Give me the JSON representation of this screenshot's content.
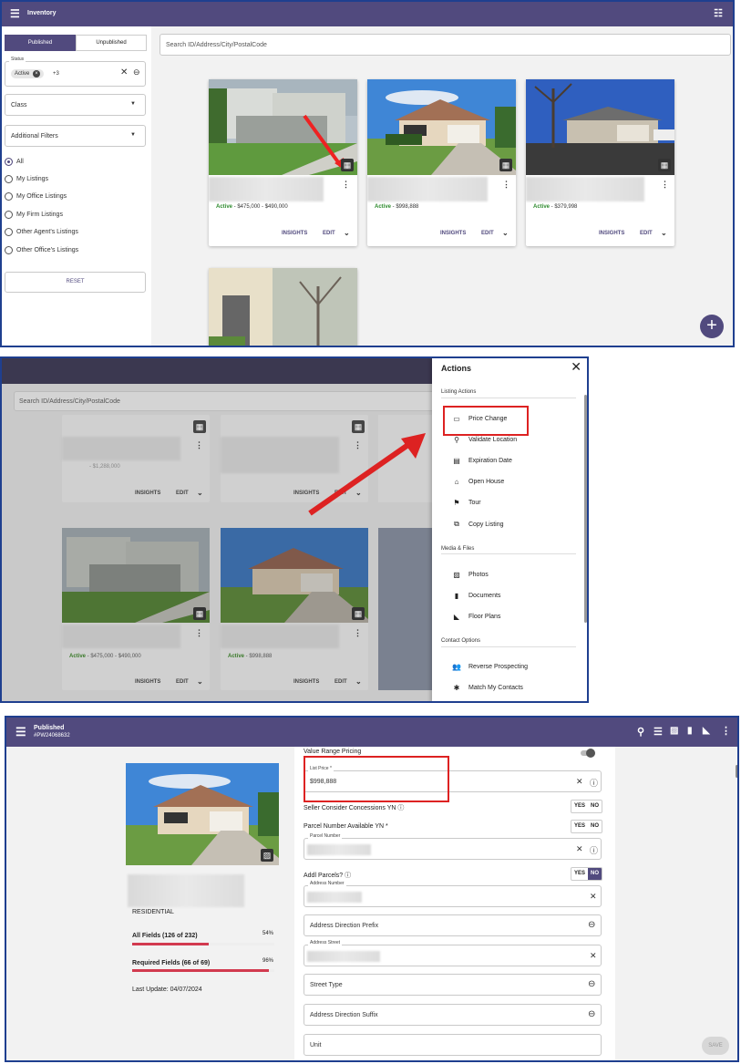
{
  "panel1": {
    "header": {
      "title": "Inventory"
    },
    "tabs": {
      "published": "Published",
      "unpublished": "Unpublished"
    },
    "search": {
      "placeholder": "Search ID/Address/City/PostalCode"
    },
    "status_filter": {
      "label": "Status",
      "chip": "Active",
      "more": "+3"
    },
    "class_select": {
      "label": "Class"
    },
    "additional_filters": {
      "label": "Additional Filters"
    },
    "radios": [
      "All",
      "My Listings",
      "My Office Listings",
      "My Firm Listings",
      "Other Agent's Listings",
      "Other Office's Listings"
    ],
    "reset": "RESET",
    "cards": [
      {
        "status": "Active",
        "price": " - $475,000 - $490,000",
        "insights": "INSIGHTS",
        "edit": "EDIT"
      },
      {
        "status": "Active",
        "price": " - $998,888",
        "insights": "INSIGHTS",
        "edit": "EDIT"
      },
      {
        "status": "Active",
        "price": " - $379,998",
        "insights": "INSIGHTS",
        "edit": "EDIT"
      }
    ]
  },
  "panel2": {
    "search": {
      "placeholder": "Search ID/Address/City/PostalCode"
    },
    "top_price": "- $1,288,000",
    "cards": [
      {
        "status": "Active",
        "price": " - $475,000 - $490,000",
        "insights": "INSIGHTS",
        "edit": "EDIT"
      },
      {
        "status": "Active",
        "price": " - $998,888",
        "insights": "INSIGHTS",
        "edit": "EDIT"
      }
    ],
    "top_cards": [
      {
        "insights": "INSIGHTS",
        "edit": "EDIT"
      },
      {
        "insights": "INSIGHTS",
        "edit": "EDIT"
      }
    ],
    "actions": {
      "title": "Actions",
      "sections": {
        "listing": "Listing Actions",
        "media": "Media & Files",
        "contact": "Contact Options"
      },
      "listing_items": [
        {
          "label": "Price Change",
          "icon": "price-tag-icon"
        },
        {
          "label": "Validate Location",
          "icon": "person-pin-icon"
        },
        {
          "label": "Expiration Date",
          "icon": "calendar-icon"
        },
        {
          "label": "Open House",
          "icon": "house-icon"
        },
        {
          "label": "Tour",
          "icon": "flag-icon"
        },
        {
          "label": "Copy Listing",
          "icon": "copy-icon"
        }
      ],
      "media_items": [
        {
          "label": "Photos",
          "icon": "photo-icon"
        },
        {
          "label": "Documents",
          "icon": "document-icon"
        },
        {
          "label": "Floor Plans",
          "icon": "floor-plan-icon"
        }
      ],
      "contact_items": [
        {
          "label": "Reverse Prospecting",
          "icon": "people-icon"
        },
        {
          "label": "Match My Contacts",
          "icon": "person-icon"
        }
      ]
    }
  },
  "panel3": {
    "header": {
      "title": "Published",
      "subtitle": "#PW24068632"
    },
    "property_type": "RESIDENTIAL",
    "all_fields": {
      "label": "All Fields (126 of 232)",
      "pct": "54%",
      "value": 0.54
    },
    "required_fields": {
      "label": "Required Fields (66 of 69)",
      "pct": "96%",
      "value": 0.96
    },
    "last_update": "Last Update: 04/07/2024",
    "value_range_pricing": "Value Range Pricing",
    "list_price": {
      "label": "List Price *",
      "value": "$998,888"
    },
    "seller_concessions": {
      "label": "Seller Consider Concessions YN",
      "yes": "YES",
      "no": "NO"
    },
    "parcel_available": {
      "label": "Parcel Number Available YN *",
      "yes": "YES",
      "no": "NO"
    },
    "parcel_number": {
      "label": "Parcel Number"
    },
    "addl_parcels": {
      "label": "Addl Parcels?",
      "yes": "YES",
      "no": "NO"
    },
    "address_number": {
      "label": "Address Number"
    },
    "address_direction_prefix": {
      "placeholder": "Address Direction Prefix"
    },
    "address_street": {
      "label": "Address Street"
    },
    "street_type": {
      "placeholder": "Street Type"
    },
    "address_direction_suffix": {
      "placeholder": "Address Direction Suffix"
    },
    "unit": {
      "placeholder": "Unit"
    },
    "save": "SAVE"
  },
  "colors": {
    "header": "#514a7e",
    "accent_green": "#2e8b2e",
    "annotation_red": "#dd2222",
    "progress_red": "#d23a4f"
  }
}
